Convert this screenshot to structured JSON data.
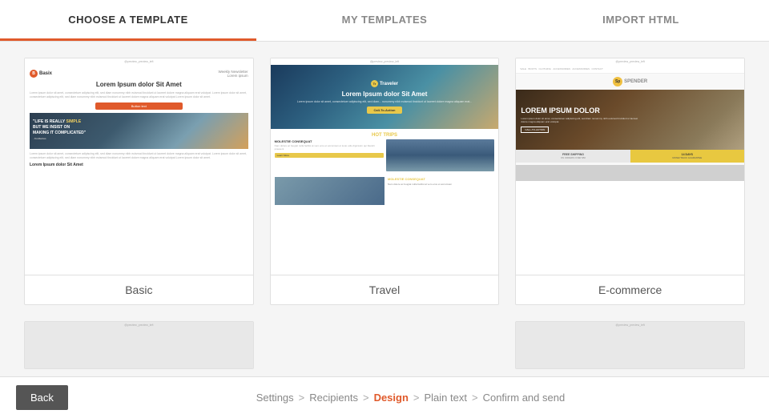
{
  "nav": {
    "tabs": [
      {
        "id": "choose-template",
        "label": "CHOOSE A TEMPLATE",
        "active": true
      },
      {
        "id": "my-templates",
        "label": "MY TEMPLATES",
        "active": false
      },
      {
        "id": "import-html",
        "label": "IMPORT HTML",
        "active": false
      }
    ]
  },
  "templates": [
    {
      "id": "basic",
      "label": "Basic",
      "preview_type": "basic"
    },
    {
      "id": "travel",
      "label": "Travel",
      "preview_type": "travel"
    },
    {
      "id": "ecommerce",
      "label": "E-commerce",
      "preview_type": "ecommerce"
    }
  ],
  "partial_templates": [
    {
      "id": "partial1",
      "label": ""
    },
    {
      "id": "partial2",
      "label": ""
    }
  ],
  "bottom": {
    "back_label": "Back",
    "breadcrumb": [
      {
        "id": "settings",
        "label": "Settings",
        "active": false
      },
      {
        "id": "recipients",
        "label": "Recipients",
        "active": false
      },
      {
        "id": "design",
        "label": "Design",
        "active": true
      },
      {
        "id": "plain-text",
        "label": "Plain text",
        "active": false
      },
      {
        "id": "confirm",
        "label": "Confirm and send",
        "active": false
      }
    ],
    "breadcrumb_separator": ">"
  },
  "preview_top_label": "@preview_preview_left"
}
